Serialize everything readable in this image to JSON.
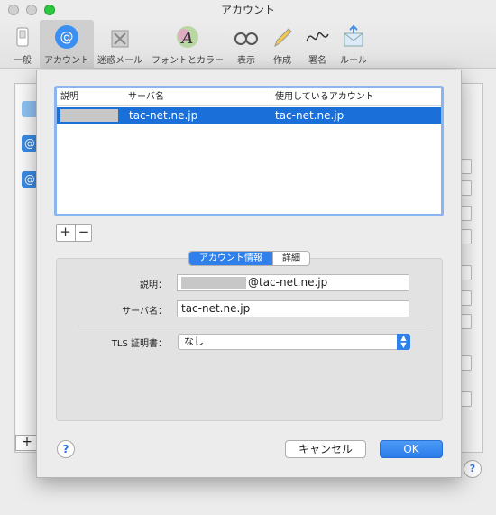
{
  "window": {
    "title": "アカウント"
  },
  "toolbar": {
    "items": [
      {
        "label": "一般",
        "icon": "switch-icon"
      },
      {
        "label": "アカウント",
        "icon": "at-icon",
        "active": true
      },
      {
        "label": "迷惑メール",
        "icon": "junk-trash-icon"
      },
      {
        "label": "フォントとカラー",
        "icon": "font-color-icon"
      },
      {
        "label": "表示",
        "icon": "glasses-icon"
      },
      {
        "label": "作成",
        "icon": "pencil-icon"
      },
      {
        "label": "署名",
        "icon": "signature-icon"
      },
      {
        "label": "ルール",
        "icon": "rules-envelope-icon"
      }
    ]
  },
  "sheet": {
    "table": {
      "headers": [
        "説明",
        "サーバ名",
        "使用しているアカウント"
      ],
      "rows": [
        {
          "description": "",
          "server": "tac-net.ne.jp",
          "account": "tac-net.ne.jp"
        }
      ]
    },
    "add_button": "+",
    "remove_button": "−",
    "tabs": [
      "アカウント情報",
      "詳細"
    ],
    "form": {
      "description_label": "説明：",
      "description_value": "@tac-net.ne.jp",
      "server_label": "サーバ名：",
      "server_value": "tac-net.ne.jp",
      "tls_label": "TLS 証明書：",
      "tls_value": "なし"
    },
    "help": "?",
    "cancel_button": "キャンセル",
    "ok_button": "OK"
  },
  "colors": {
    "accent": "#2f80ea",
    "selection": "#1a6fd8"
  }
}
